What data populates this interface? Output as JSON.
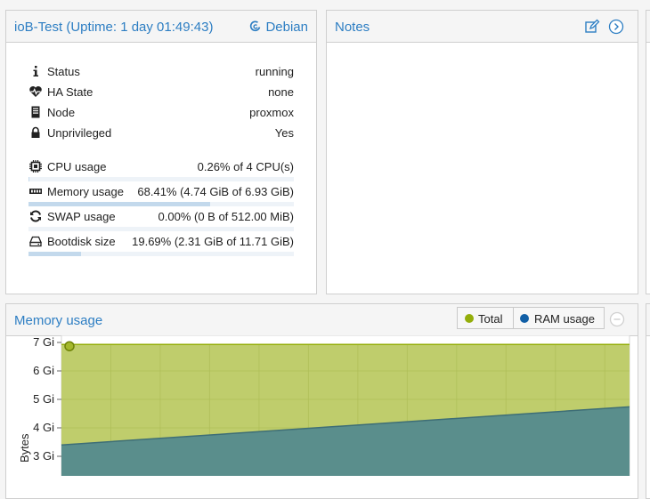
{
  "summary": {
    "title": "ioB-Test (Uptime: 1 day 01:49:43)",
    "os": "Debian",
    "status": [
      {
        "label": "Status",
        "value": "running",
        "icon": "info-icon"
      },
      {
        "label": "HA State",
        "value": "none",
        "icon": "heartbeat-icon"
      },
      {
        "label": "Node",
        "value": "proxmox",
        "icon": "server-icon"
      },
      {
        "label": "Unprivileged",
        "value": "Yes",
        "icon": "lock-icon"
      }
    ],
    "usage": [
      {
        "label": "CPU usage",
        "value": "0.26% of 4 CPU(s)",
        "icon": "cpu-icon",
        "percent": 0.26
      },
      {
        "label": "Memory usage",
        "value": "68.41% (4.74 GiB of 6.93 GiB)",
        "icon": "memory-icon",
        "percent": 68.41
      },
      {
        "label": "SWAP usage",
        "value": "0.00% (0 B of 512.00 MiB)",
        "icon": "refresh-icon",
        "percent": 0
      },
      {
        "label": "Bootdisk size",
        "value": "19.69% (2.31 GiB of 11.71 GiB)",
        "icon": "hdd-icon",
        "percent": 19.69
      }
    ]
  },
  "notes": {
    "title": "Notes"
  },
  "chart": {
    "title": "Memory usage",
    "ylabel": "Bytes",
    "legend": [
      {
        "name": "Total",
        "color": "#94ae0a"
      },
      {
        "name": "RAM usage",
        "color": "#115fa6"
      }
    ]
  },
  "chart_data": {
    "type": "area",
    "title": "Memory usage",
    "ylabel": "Bytes",
    "xlabel": "",
    "yticks": [
      "3 Gi",
      "4 Gi",
      "5 Gi",
      "6 Gi",
      "7 Gi"
    ],
    "ylim": [
      2.4,
      7.0
    ],
    "series": [
      {
        "name": "Total",
        "values": [
          6.93,
          6.93
        ],
        "color": "#94ae0a"
      },
      {
        "name": "RAM usage",
        "values": [
          3.4,
          4.74
        ],
        "color": "#115fa6"
      }
    ]
  }
}
